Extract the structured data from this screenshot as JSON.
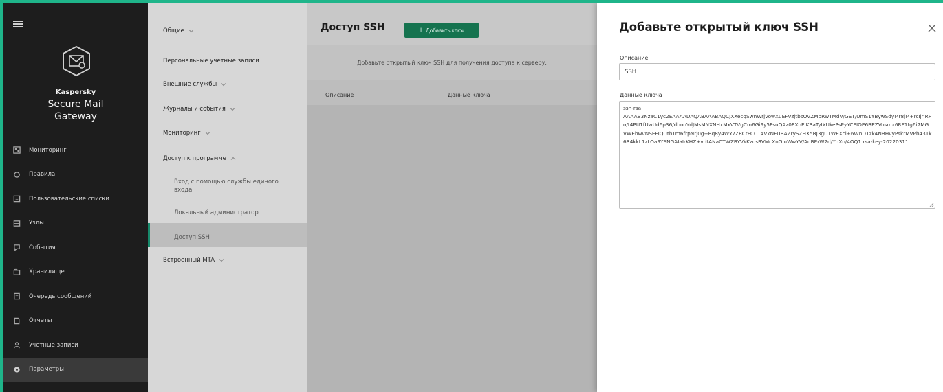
{
  "brand": {
    "company": "Kaspersky",
    "product": "Secure Mail Gateway"
  },
  "nav": {
    "items": [
      {
        "label": "Мониторинг",
        "icon": "monitor-icon"
      },
      {
        "label": "Правила",
        "icon": "circle-icon"
      },
      {
        "label": "Пользовательские списки",
        "icon": "list-icon"
      },
      {
        "label": "Узлы",
        "icon": "server-icon"
      },
      {
        "label": "События",
        "icon": "events-icon"
      },
      {
        "label": "Хранилище",
        "icon": "storage-icon"
      },
      {
        "label": "Очередь сообщений",
        "icon": "queue-icon"
      },
      {
        "label": "Отчеты",
        "icon": "report-icon"
      },
      {
        "label": "Учетные записи",
        "icon": "user-icon"
      },
      {
        "label": "Параметры",
        "icon": "gear-icon"
      }
    ],
    "active": "Параметры"
  },
  "settings_menu": {
    "general": "Общие",
    "personal_accounts": "Персональные учетные записи",
    "external_services": "Внешние службы",
    "logs_events": "Журналы и события",
    "monitoring": "Мониторинг",
    "program_access": "Доступ к программе",
    "sso_login": "Вход с помощью службы единого входа",
    "local_admin": "Локальный администратор",
    "ssh_access": "Доступ SSH",
    "builtin_mta": "Встроенный MTA"
  },
  "main": {
    "title": "Доступ SSH",
    "add_key_label": "Добавить ключ",
    "hint": "Добавьте открытый ключ SSH для получения доступа к серверу.",
    "columns": [
      "Описание",
      "Данные ключа"
    ]
  },
  "dialog": {
    "title": "Добавьте открытый ключ SSH",
    "description_label": "Описание",
    "description_value": "SSH",
    "key_label": "Данные ключа",
    "key_first_line": "ssh-rsa",
    "key_value": "AAAAB3NzaC1yc2EAAAADAQABAAABAQCJXXecqSwnWrjVowXuEFVzjtbsOVZMbRwTMdV/GET/UmS1YBywSdyMr8jM+rcIjrjRFo/t4PU1fUwUd6p36/dbooYdJMsMNXNHxMxVTVgCm6Gi9y5FsuQAz0EXoEiKBaTyIXUkePsPyYCEIOE6BEZVosmx6RF1tg6i7MGVWEbwvNSEFIQUthTm6frpNrj0g+Bq8y4Wx7ZRCtFCC14VkNFUBAZrySZHX5BJ3gUTWEXcl+6WnD1zk4NBHvyPskrMVPb43Tk6R4kkL1zLOa9YSNGAIaIrKHZ+vdtANaCTWZBYVkKzusRVMcXnGiuWwYV/AqBErW2d/YdXo/4OQ1 rsa-key-20220311"
  }
}
